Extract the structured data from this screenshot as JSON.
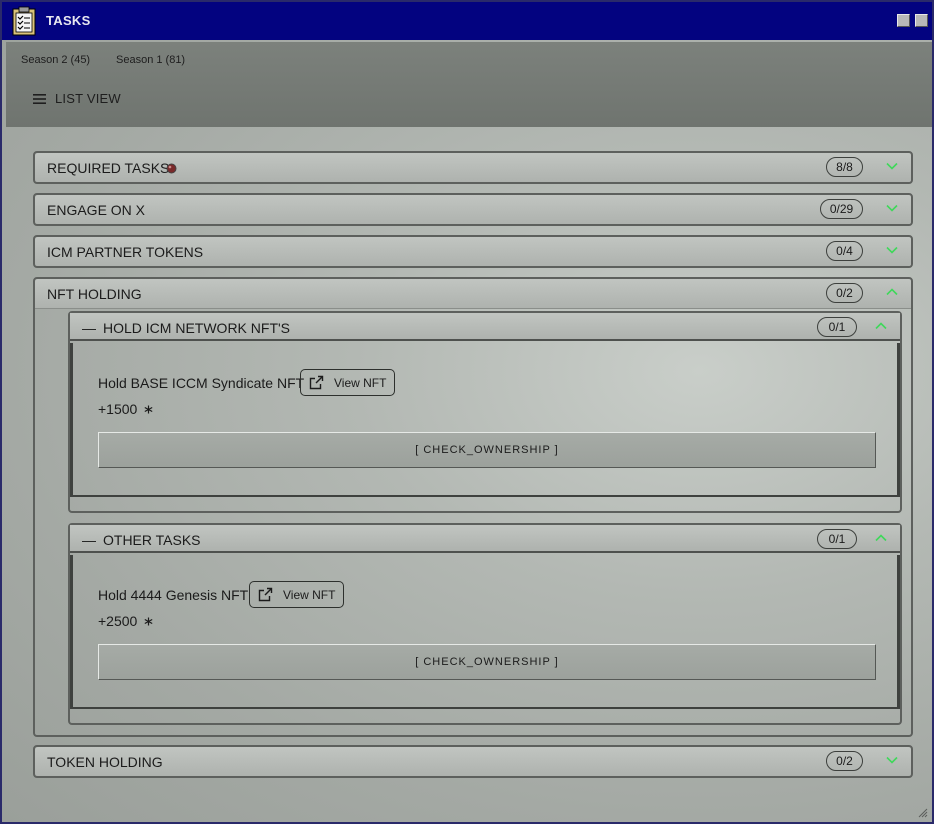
{
  "window": {
    "title": "TASKS"
  },
  "seasons": [
    {
      "label": "Season 2 (45)"
    },
    {
      "label": "Season 1 (81)"
    }
  ],
  "view_toggle": {
    "label": "LIST VIEW"
  },
  "colors": {
    "titlebar": "#030380",
    "chevron": "#3fd85a",
    "status_dot": "#7a2a2a"
  },
  "sections": {
    "required": {
      "label": "REQUIRED TASKS",
      "count": "8/8"
    },
    "engage_x": {
      "label": "ENGAGE ON X",
      "count": "0/29"
    },
    "icm_tokens": {
      "label": "ICM PARTNER TOKENS",
      "count": "0/4"
    },
    "nft_holding": {
      "label": "NFT HOLDING",
      "count": "0/2",
      "groups": {
        "icm_network": {
          "dash": "—",
          "label": "HOLD ICM NETWORK NFT'S",
          "count": "0/1",
          "task": {
            "name": "Hold BASE ICCM Syndicate NFT",
            "view_label": "View NFT",
            "points": "+1500",
            "check_label": "[ CHECK_OWNERSHIP ]"
          }
        },
        "other": {
          "dash": "—",
          "label": "OTHER TASKS",
          "count": "0/1",
          "task": {
            "name": "Hold 4444 Genesis NFT",
            "view_label": "View NFT",
            "points": "+2500",
            "check_label": "[ CHECK_OWNERSHIP ]"
          }
        }
      }
    },
    "token_holding": {
      "label": "TOKEN HOLDING",
      "count": "0/2"
    }
  }
}
